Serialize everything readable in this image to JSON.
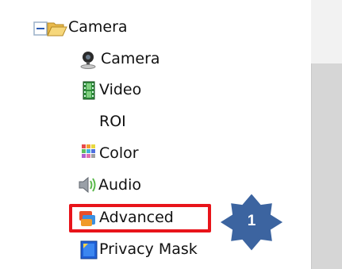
{
  "tree": {
    "root_label": "Camera",
    "root_expander": "minus",
    "items": [
      {
        "label": "Camera",
        "icon": "camera-icon"
      },
      {
        "label": "Video",
        "icon": "video-icon"
      },
      {
        "label": "ROI",
        "icon": ""
      },
      {
        "label": "Color",
        "icon": "color-icon"
      },
      {
        "label": "Audio",
        "icon": "audio-icon"
      },
      {
        "label": "Advanced",
        "icon": "advanced-icon"
      },
      {
        "label": "Privacy Mask",
        "icon": "privacy-mask-icon"
      }
    ]
  },
  "annotation": {
    "step_number": "1",
    "highlight_color": "#e8141a",
    "badge_color": "#3c64a0"
  }
}
